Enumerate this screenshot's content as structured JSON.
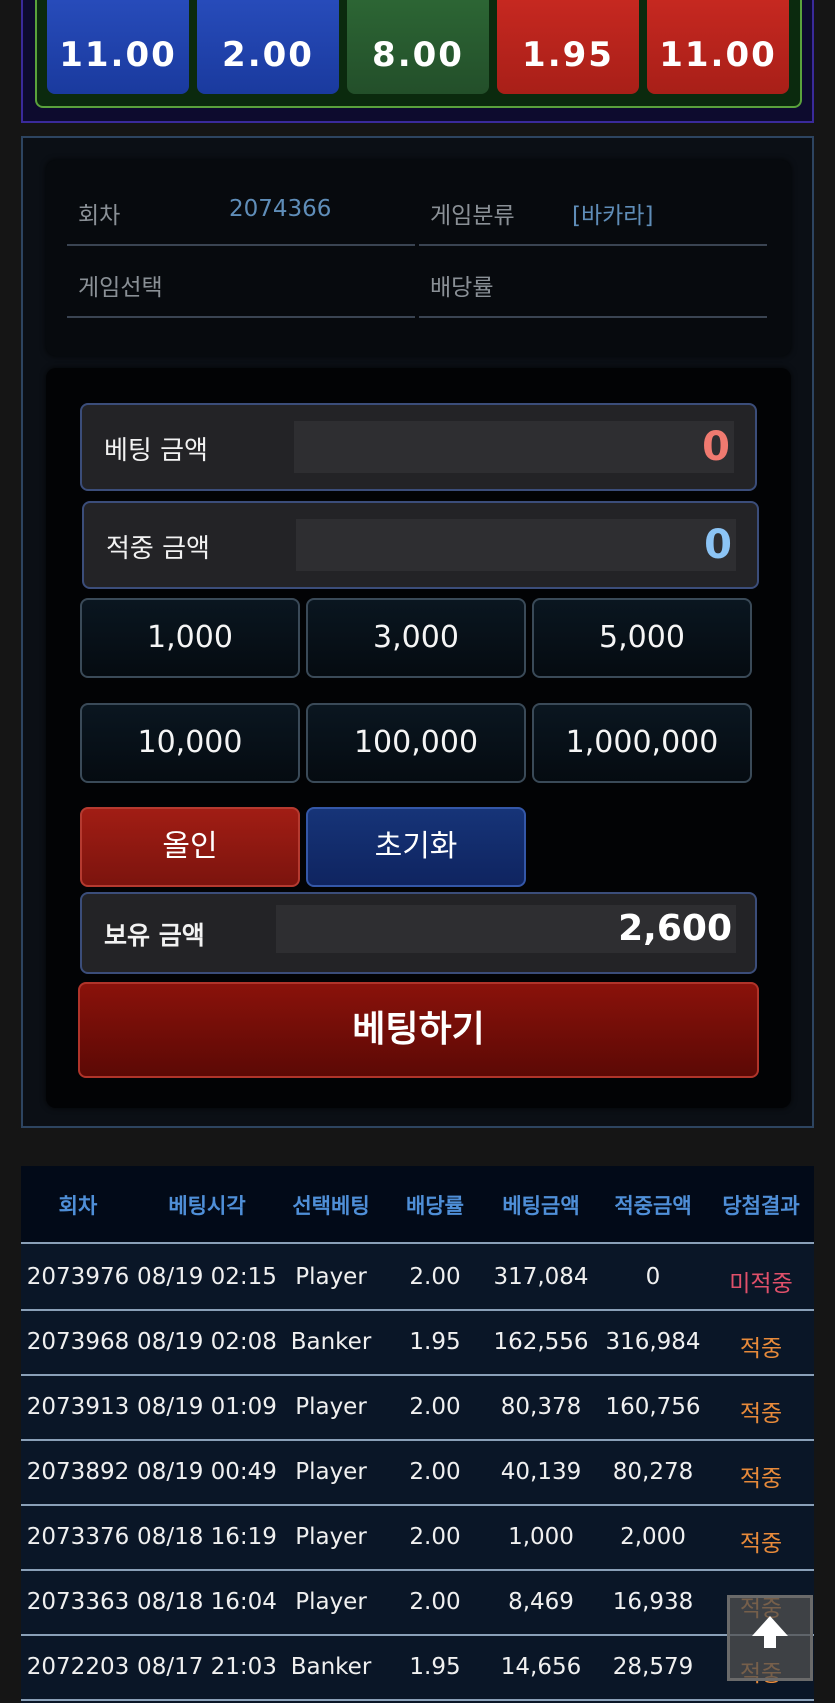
{
  "odds": [
    "11.00",
    "2.00",
    "8.00",
    "1.95",
    "11.00"
  ],
  "info": {
    "round_label": "회차",
    "round_value": "2074366",
    "category_label": "게임분류",
    "category_value": "[바카라]",
    "selection_label": "게임선택",
    "selection_value": "",
    "rate_label": "배당률",
    "rate_value": ""
  },
  "bet": {
    "bet_amount_label": "베팅 금액",
    "bet_amount_value": "0",
    "win_amount_label": "적중 금액",
    "win_amount_value": "0",
    "chips": [
      "1,000",
      "3,000",
      "5,000",
      "10,000",
      "100,000",
      "1,000,000"
    ],
    "allin_label": "올인",
    "reset_label": "초기화",
    "balance_label": "보유 금액",
    "balance_value": "2,600",
    "submit_label": "베팅하기"
  },
  "history": {
    "headers": [
      "회차",
      "베팅시각",
      "선택베팅",
      "배당률",
      "베팅금액",
      "적중금액",
      "당첨결과"
    ],
    "rows": [
      [
        "2073976",
        "08/19 02:15",
        "Player",
        "2.00",
        "317,084",
        "0",
        "미적중"
      ],
      [
        "2073968",
        "08/19 02:08",
        "Banker",
        "1.95",
        "162,556",
        "316,984",
        "적중"
      ],
      [
        "2073913",
        "08/19 01:09",
        "Player",
        "2.00",
        "80,378",
        "160,756",
        "적중"
      ],
      [
        "2073892",
        "08/19 00:49",
        "Player",
        "2.00",
        "40,139",
        "80,278",
        "적중"
      ],
      [
        "2073376",
        "08/18 16:19",
        "Player",
        "2.00",
        "1,000",
        "2,000",
        "적중"
      ],
      [
        "2073363",
        "08/18 16:04",
        "Player",
        "2.00",
        "8,469",
        "16,938",
        "적중"
      ],
      [
        "2072203",
        "08/17 21:03",
        "Banker",
        "1.95",
        "14,656",
        "28,579",
        "적중"
      ]
    ]
  },
  "icons": {
    "scroll_top": "arrow-up-icon"
  },
  "colors": {
    "miss": "#e0506a",
    "hit": "#e88a3a",
    "header": "#4f8fd8"
  }
}
